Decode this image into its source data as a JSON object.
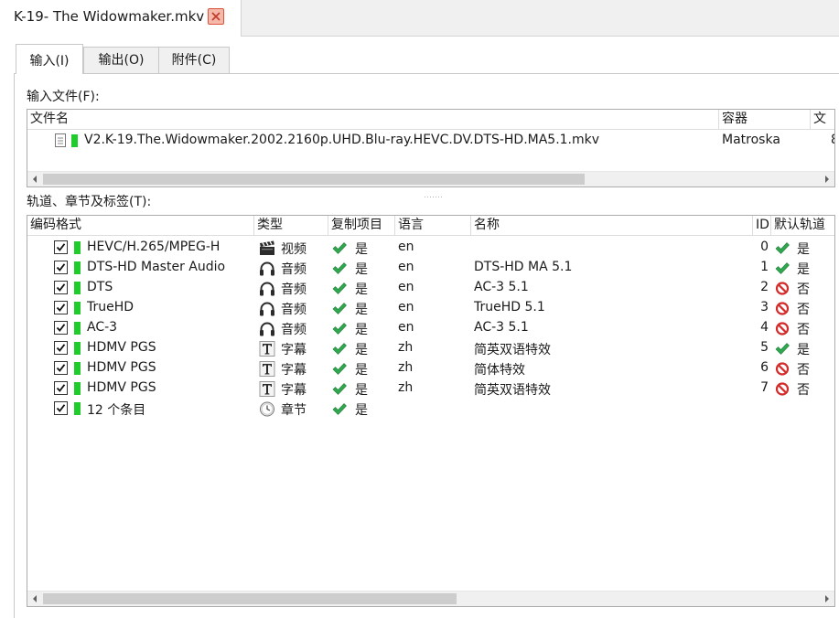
{
  "document_tab": {
    "title": "K-19- The Widowmaker.mkv"
  },
  "subtabs": [
    {
      "label": "输入(I)"
    },
    {
      "label": "输出(O)"
    },
    {
      "label": "附件(C)"
    }
  ],
  "input_files": {
    "label": "输入文件(F):",
    "columns": [
      "文件名",
      "容器",
      "文"
    ],
    "rows": [
      {
        "filename": "V2.K-19.The.Widowmaker.2002.2160p.UHD.Blu-ray.HEVC.DV.DTS-HD.MA5.1.mkv",
        "container": "Matroska",
        "extra": "8"
      }
    ]
  },
  "tracks": {
    "label": "轨道、章节及标签(T):",
    "columns": [
      "编码格式",
      "类型",
      "复制项目",
      "语言",
      "名称",
      "ID",
      "默认轨道"
    ],
    "rows": [
      {
        "codec": "HEVC/H.265/MPEG-H",
        "type_icon": "video-clapper-icon",
        "type": "视频",
        "copy": "是",
        "lang": "en",
        "name": "",
        "id": "0",
        "default_icon": "check-icon",
        "default": "是"
      },
      {
        "codec": "DTS-HD Master Audio",
        "type_icon": "headphones-icon",
        "type": "音频",
        "copy": "是",
        "lang": "en",
        "name": "DTS-HD MA 5.1",
        "id": "1",
        "default_icon": "check-icon",
        "default": "是"
      },
      {
        "codec": "DTS",
        "type_icon": "headphones-icon",
        "type": "音频",
        "copy": "是",
        "lang": "en",
        "name": "AC-3 5.1",
        "id": "2",
        "default_icon": "prohibited-icon",
        "default": "否"
      },
      {
        "codec": "TrueHD",
        "type_icon": "headphones-icon",
        "type": "音频",
        "copy": "是",
        "lang": "en",
        "name": "TrueHD 5.1",
        "id": "3",
        "default_icon": "prohibited-icon",
        "default": "否"
      },
      {
        "codec": "AC-3",
        "type_icon": "headphones-icon",
        "type": "音频",
        "copy": "是",
        "lang": "en",
        "name": "AC-3 5.1",
        "id": "4",
        "default_icon": "prohibited-icon",
        "default": "否"
      },
      {
        "codec": "HDMV PGS",
        "type_icon": "text-t-icon",
        "type": "字幕",
        "copy": "是",
        "lang": "zh",
        "name": "简英双语特效",
        "id": "5",
        "default_icon": "check-icon",
        "default": "是"
      },
      {
        "codec": "HDMV PGS",
        "type_icon": "text-t-icon",
        "type": "字幕",
        "copy": "是",
        "lang": "zh",
        "name": "简体特效",
        "id": "6",
        "default_icon": "prohibited-icon",
        "default": "否"
      },
      {
        "codec": "HDMV PGS",
        "type_icon": "text-t-icon",
        "type": "字幕",
        "copy": "是",
        "lang": "zh",
        "name": "简英双语特效",
        "id": "7",
        "default_icon": "prohibited-icon",
        "default": "否"
      },
      {
        "codec": "12 个条目",
        "type_icon": "clock-icon",
        "type": "章节",
        "copy": "是",
        "lang": "",
        "name": "",
        "id": "",
        "default_icon": "",
        "default": ""
      }
    ]
  },
  "colors": {
    "accent_green": "#1fcc2c",
    "check_green": "#2fa84f",
    "prohibit_red": "#d42a2a",
    "close_red": "#d9543a"
  }
}
